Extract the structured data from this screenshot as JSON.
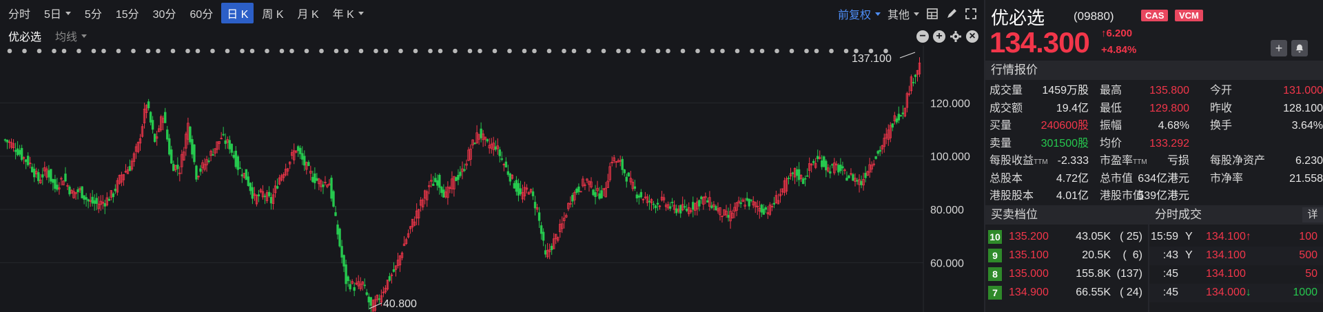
{
  "toolbar": {
    "periods": [
      {
        "label": "分时",
        "dd": false,
        "sel": false
      },
      {
        "label": "5日",
        "dd": true,
        "sel": false
      },
      {
        "label": "5分",
        "dd": false,
        "sel": false
      },
      {
        "label": "15分",
        "dd": false,
        "sel": false
      },
      {
        "label": "30分",
        "dd": false,
        "sel": false
      },
      {
        "label": "60分",
        "dd": false,
        "sel": false
      },
      {
        "label": "日 K",
        "dd": false,
        "sel": true
      },
      {
        "label": "周 K",
        "dd": false,
        "sel": false
      },
      {
        "label": "月 K",
        "dd": false,
        "sel": false
      },
      {
        "label": "年 K",
        "dd": true,
        "sel": false
      }
    ],
    "adjust": "前复权",
    "other": "其他"
  },
  "subbar": {
    "stock_label": "优必选",
    "ma_label": "均线"
  },
  "stock": {
    "name": "优必选",
    "code": "(09880)",
    "badges": [
      "CAS",
      "VCM"
    ],
    "price": "134.300",
    "change": "6.200",
    "change_pct": "+4.84%"
  },
  "quote": {
    "header": "行情报价",
    "rows": [
      [
        {
          "k": "成交量",
          "v": "1459万股",
          "c": "wht"
        },
        {
          "k": "最高",
          "v": "135.800",
          "c": "red"
        },
        {
          "k": "今开",
          "v": "131.000",
          "c": "red"
        }
      ],
      [
        {
          "k": "成交额",
          "v": "19.4亿",
          "c": "wht"
        },
        {
          "k": "最低",
          "v": "129.800",
          "c": "red"
        },
        {
          "k": "昨收",
          "v": "128.100",
          "c": "wht"
        }
      ],
      [
        {
          "k": "买量",
          "v": "240600股",
          "c": "red"
        },
        {
          "k": "振幅",
          "v": "4.68%",
          "c": "wht"
        },
        {
          "k": "换手",
          "v": "3.64%",
          "c": "wht"
        }
      ],
      [
        {
          "k": "卖量",
          "v": "301500股",
          "c": "green"
        },
        {
          "k": "均价",
          "v": "133.292",
          "c": "red"
        },
        {
          "k": "",
          "v": "",
          "c": "wht"
        }
      ],
      [
        {
          "k": "每股收益",
          "ttm": "TTM",
          "v": "-2.333",
          "c": "wht"
        },
        {
          "k": "市盈率",
          "ttm": "TTM",
          "v": "亏损",
          "c": "wht"
        },
        {
          "k": "每股净资产",
          "v": "6.230",
          "c": "wht"
        }
      ],
      [
        {
          "k": "总股本",
          "v": "4.72亿",
          "c": "wht"
        },
        {
          "k": "总市值",
          "v": "634亿港元",
          "c": "wht"
        },
        {
          "k": "市净率",
          "v": "21.558",
          "c": "wht"
        }
      ],
      [
        {
          "k": "港股股本",
          "v": "4.01亿",
          "c": "wht"
        },
        {
          "k": "港股市值",
          "v": "539亿港元",
          "c": "wht"
        },
        {
          "k": "",
          "v": "",
          "c": "wht"
        }
      ]
    ]
  },
  "orderbook": {
    "header": "买卖档位",
    "rows": [
      {
        "lvl": "10",
        "price": "135.200",
        "vol": "43.05K",
        "cnt": "( 25)"
      },
      {
        "lvl": "9",
        "price": "135.100",
        "vol": "20.5K",
        "cnt": "(  6)"
      },
      {
        "lvl": "8",
        "price": "135.000",
        "vol": "155.8K",
        "cnt": "(137)"
      },
      {
        "lvl": "7",
        "price": "134.900",
        "vol": "66.55K",
        "cnt": "( 24)"
      }
    ]
  },
  "ticks": {
    "header": "分时成交",
    "detail": "详",
    "rows": [
      {
        "t": "15:59",
        "f": "Y",
        "p": "134.100",
        "a": "up",
        "v": "100",
        "vc": "red"
      },
      {
        "t": ":43",
        "f": "Y",
        "p": "134.100",
        "a": "",
        "v": "500",
        "vc": "red"
      },
      {
        "t": ":45",
        "f": "",
        "p": "134.100",
        "a": "",
        "v": "50",
        "vc": "red"
      },
      {
        "t": ":45",
        "f": "",
        "p": "134.000",
        "a": "down",
        "v": "1000",
        "vc": "green"
      }
    ]
  },
  "chart_data": {
    "type": "candlestick",
    "yticks": [
      "120.000",
      "100.000",
      "80.000",
      "60.000"
    ],
    "ylim": [
      42,
      140
    ],
    "high_label": "137.100",
    "low_label": "40.800",
    "colors": {
      "up": "#f2364a",
      "down": "#26c84e",
      "bg": "#17181c",
      "grid": "#26272d"
    },
    "closes": [
      106,
      104,
      100,
      97,
      91,
      95,
      88,
      92,
      86,
      87,
      83,
      82,
      83,
      86,
      93,
      96,
      104,
      120,
      105,
      116,
      97,
      95,
      112,
      93,
      97,
      102,
      107,
      104,
      96,
      92,
      84,
      86,
      83,
      92,
      97,
      103,
      97,
      92,
      90,
      90,
      71,
      53,
      51,
      52,
      43,
      47,
      53,
      58,
      67,
      75,
      82,
      89,
      91,
      85,
      91,
      94,
      103,
      109,
      104,
      104,
      97,
      91,
      85,
      88,
      80,
      62,
      68,
      74,
      84,
      88,
      91,
      86,
      86,
      99,
      97,
      91,
      86,
      84,
      82,
      83,
      81,
      80,
      80,
      82,
      84,
      82,
      79,
      77,
      81,
      83,
      82,
      80,
      80,
      85,
      90,
      94,
      91,
      97,
      99,
      95,
      96,
      93,
      92,
      90,
      97,
      101,
      107,
      114,
      117,
      128,
      134.3
    ]
  }
}
